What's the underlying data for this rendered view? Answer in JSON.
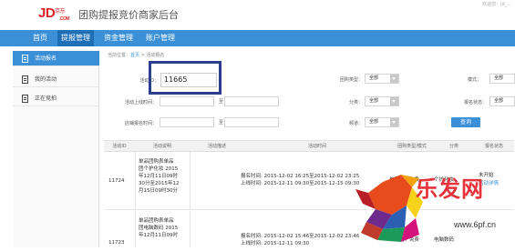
{
  "header": {
    "logo_text": "JD",
    "logo_cn": "京东",
    "logo_com": ".COM",
    "app_title": "团购提报竞价商家后台",
    "user_info": "欢迎您：jd_..."
  },
  "nav": {
    "items": [
      {
        "label": "首页"
      },
      {
        "label": "提报管理"
      },
      {
        "label": "资金管理"
      },
      {
        "label": "账户管理"
      }
    ]
  },
  "sidebar": {
    "items": [
      {
        "label": "活动报名"
      },
      {
        "label": "我的活动"
      },
      {
        "label": "正在竞拍"
      }
    ]
  },
  "breadcrumb": {
    "prefix": "当前位置：",
    "home": "首页",
    "sep": " > ",
    "current": "活动报名"
  },
  "filters": {
    "activity_id_label": "活动ID：",
    "activity_id_value": "11665",
    "group_type_label": "团购类型：",
    "group_type_value": "全部",
    "mode_label": "模式：",
    "mode_value": "全部",
    "online_time_label": "活动上线时间：",
    "to1": "至",
    "category_label": "分类：",
    "category_value": "全部",
    "signup_status_label": "报名状态：",
    "signup_status_value": "全部",
    "signup_time_label": "店铺报名时间：",
    "to2": "至",
    "channel_label": "频道：",
    "channel_value": "全部",
    "query_button": "查询"
  },
  "table": {
    "headers": [
      "活动ID",
      "活动说明",
      "活动描述",
      "活动时间",
      "团购类型/模式",
      "分类",
      "报名状态"
    ],
    "rows": [
      {
        "id": "11724",
        "desc_lines": [
          "单品团购表单品",
          "团个护化妆 2015",
          "年12月11日09时",
          "30分至2015年12",
          "月15日09时30分"
        ],
        "time_lines": [
          "报名时间: 2015-12-02 16:25至2015-12-02 23:25",
          "上线时间: 2015-12-11 09:30至2015-12-15 09:30"
        ],
        "type": "单品团 / 免费",
        "category": "个护化妆",
        "status": "未开始",
        "status_link": "活动详情"
      },
      {
        "id": "11723",
        "desc_lines": [
          "单品团购表单品",
          "团电脑数码 2015",
          "年12月11日09时"
        ],
        "time_lines": [
          "报名时间: 2015-12-02 15:46至2015-12-02 23:46",
          "上线时间: 2015-12-11 09:30"
        ],
        "type": "单品团 / 免费",
        "category": "电脑数码",
        "status": "未开始",
        "status_link": "活动详情"
      }
    ]
  },
  "watermark": {
    "text": "乐发网",
    "url": "www.6pf.cn"
  },
  "colors": {
    "nav_bg": "#3a8fd6",
    "nav_active": "#1f6fb6",
    "brand_red": "#d9252a",
    "highlight_border": "#2c3f8f"
  }
}
